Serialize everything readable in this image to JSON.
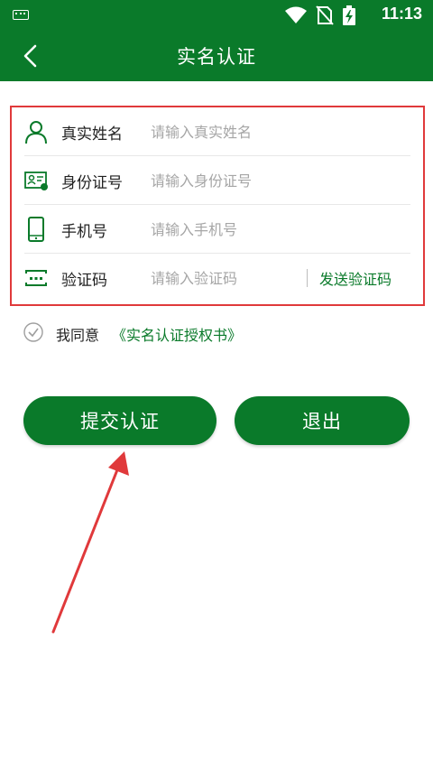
{
  "status_bar": {
    "time": "11:13",
    "icons": [
      "keyboard-icon",
      "wifi-icon",
      "no-sim-icon",
      "battery-charging-icon"
    ]
  },
  "app_bar": {
    "title": "实名认证",
    "back_icon": "chevron-left-icon"
  },
  "form": {
    "rows": [
      {
        "icon": "person-icon",
        "label": "真实姓名",
        "placeholder": "请输入真实姓名",
        "value": ""
      },
      {
        "icon": "id-card-icon",
        "label": "身份证号",
        "placeholder": "请输入身份证号",
        "value": ""
      },
      {
        "icon": "phone-icon",
        "label": "手机号",
        "placeholder": "请输入手机号",
        "value": ""
      },
      {
        "icon": "code-icon",
        "label": "验证码",
        "placeholder": "请输入验证码",
        "value": ""
      }
    ],
    "send_code_label": "发送验证码"
  },
  "agreement": {
    "checked": false,
    "text": "我同意",
    "link": "《实名认证授权书》"
  },
  "buttons": {
    "submit_label": "提交认证",
    "exit_label": "退出"
  },
  "colors": {
    "brand": "#0a7a2a",
    "highlight": "#e0393b"
  }
}
